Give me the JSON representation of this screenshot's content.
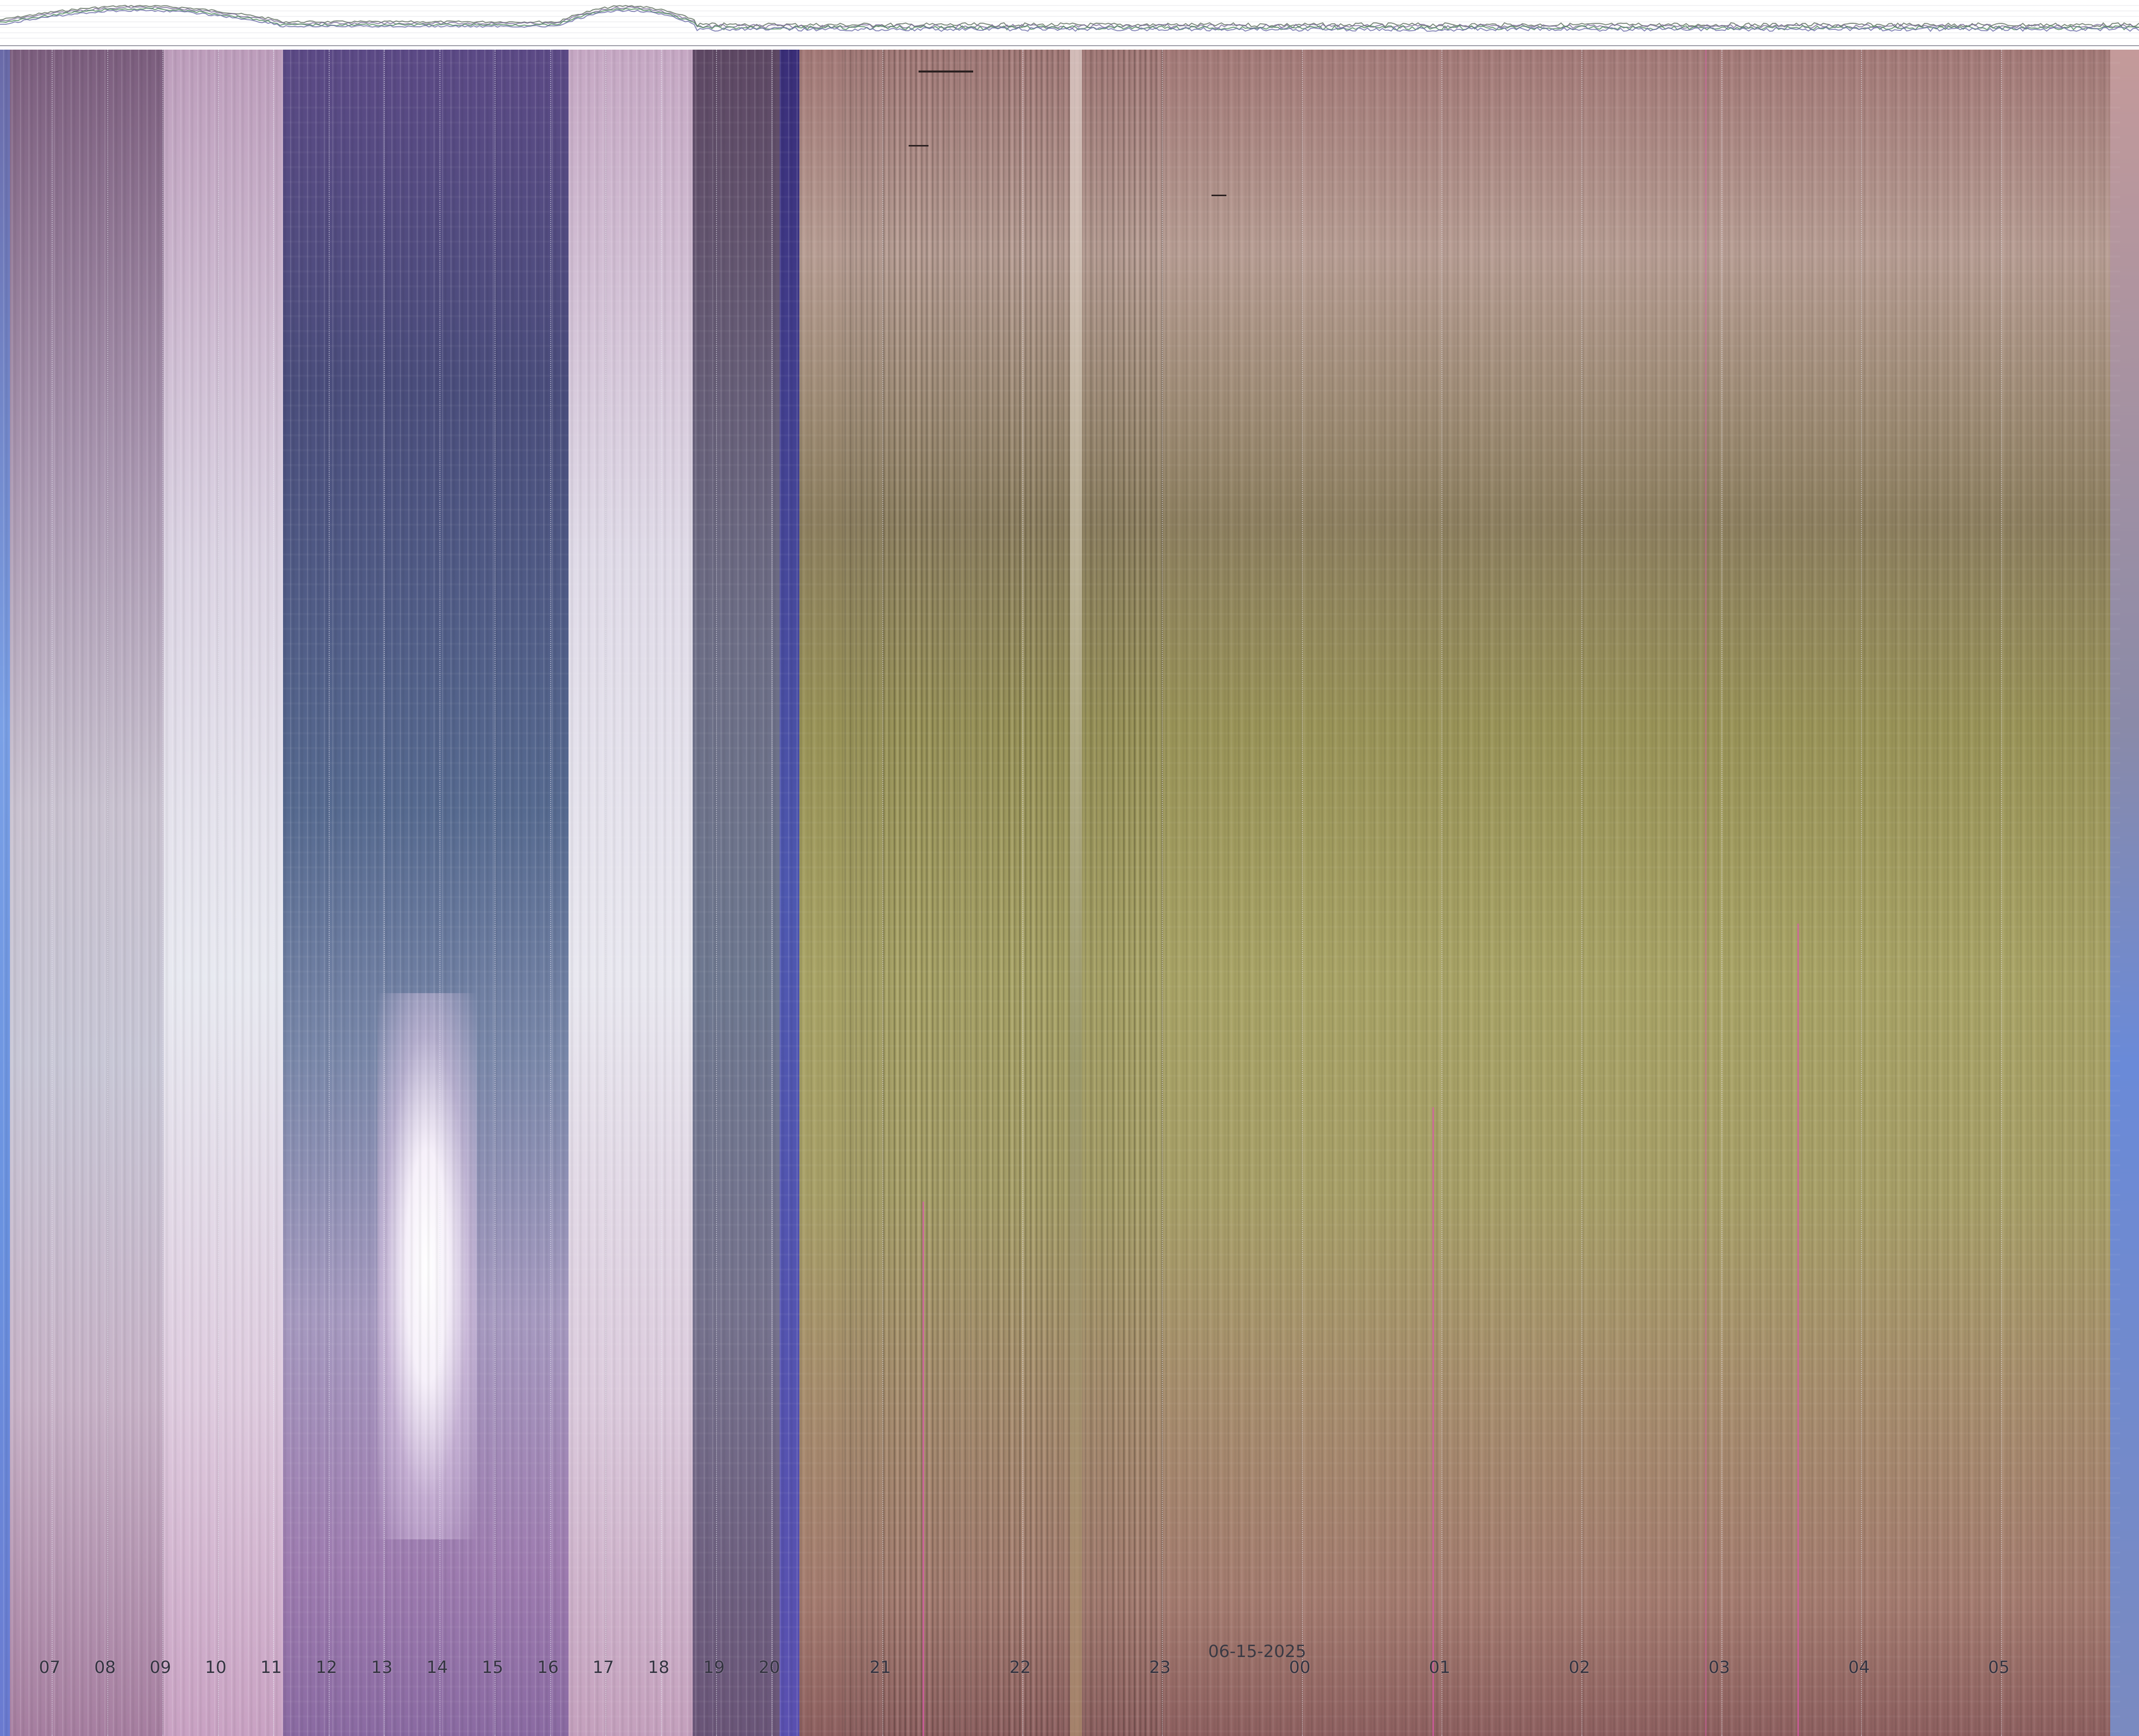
{
  "image": {
    "kind": "keogram",
    "date_label": "06-15-2025",
    "hour_labels": [
      "07",
      "08",
      "09",
      "10",
      "11",
      "12",
      "13",
      "14",
      "15",
      "16",
      "17",
      "18",
      "19",
      "20",
      "21",
      "22",
      "23",
      "00",
      "01",
      "02",
      "03",
      "04",
      "05"
    ],
    "colors": {
      "day_sky": "#c8c7d6",
      "bright_sky": "#eef0f6",
      "dark_sky": "#4a4d7c",
      "dusk_blue": "#4e58b0",
      "night_olive": "#a9a466",
      "night_rose": "#a57c70",
      "grid": "#e6e6f0",
      "label": "#333340"
    },
    "sparkline_series": [
      {
        "color": "#5a6a5a"
      },
      {
        "color": "#7a6a9a"
      },
      {
        "color": "#4a8a5a"
      },
      {
        "color": "#6a6aa8"
      }
    ]
  }
}
